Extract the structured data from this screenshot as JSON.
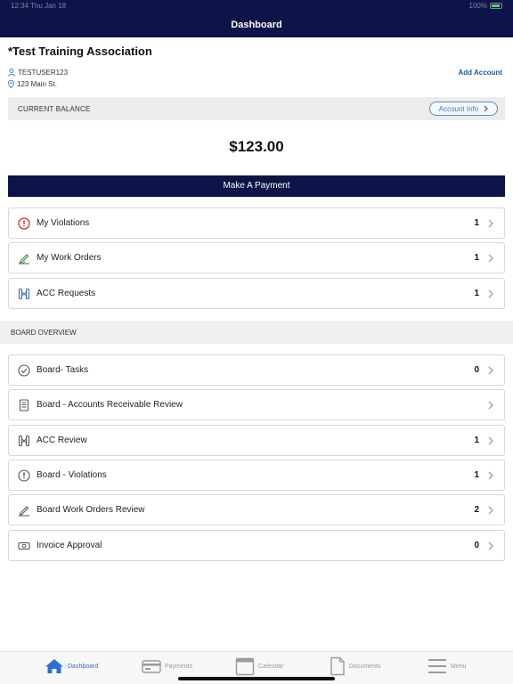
{
  "status": {
    "left": "12:34 Thu Jan 18",
    "right": "100%"
  },
  "header": {
    "title": "Dashboard"
  },
  "association": {
    "name": "*Test Training Association",
    "user": "TESTUSER123",
    "address": "123 Main St.",
    "add_account": "Add Account"
  },
  "balance": {
    "label": "CURRENT BALANCE",
    "account_info": "Account Info",
    "amount": "$123.00"
  },
  "payment": {
    "button": "Make A Payment"
  },
  "my_items": [
    {
      "label": "My Violations",
      "count": "1",
      "icon": "alert-icon"
    },
    {
      "label": "My Work Orders",
      "count": "1",
      "icon": "pencil-check-icon"
    },
    {
      "label": "ACC Requests",
      "count": "1",
      "icon": "acc-icon"
    }
  ],
  "board": {
    "section_label": "BOARD OVERVIEW",
    "items": [
      {
        "label": "Board- Tasks",
        "count": "0",
        "icon": "check-circle-icon"
      },
      {
        "label": "Board - Accounts Receivable Review",
        "count": "",
        "icon": "ledger-icon"
      },
      {
        "label": "ACC Review",
        "count": "1",
        "icon": "acc-icon"
      },
      {
        "label": "Board - Violations",
        "count": "1",
        "icon": "alert-icon"
      },
      {
        "label": "Board Work Orders Review",
        "count": "2",
        "icon": "pencil-check-icon"
      },
      {
        "label": "Invoice Approval",
        "count": "0",
        "icon": "money-icon"
      }
    ]
  },
  "tabs": [
    {
      "label": "Dashboard",
      "icon": "home-icon",
      "active": true
    },
    {
      "label": "Payments",
      "icon": "card-icon",
      "active": false
    },
    {
      "label": "Calendar",
      "icon": "calendar-icon",
      "active": false
    },
    {
      "label": "Documents",
      "icon": "document-icon",
      "active": false
    },
    {
      "label": "Menu",
      "icon": "menu-icon",
      "active": false
    }
  ],
  "colors": {
    "navy": "#0d1447",
    "accent": "#2f6fd1",
    "violation_red": "#d0312d",
    "work_green": "#3a8a3a"
  }
}
